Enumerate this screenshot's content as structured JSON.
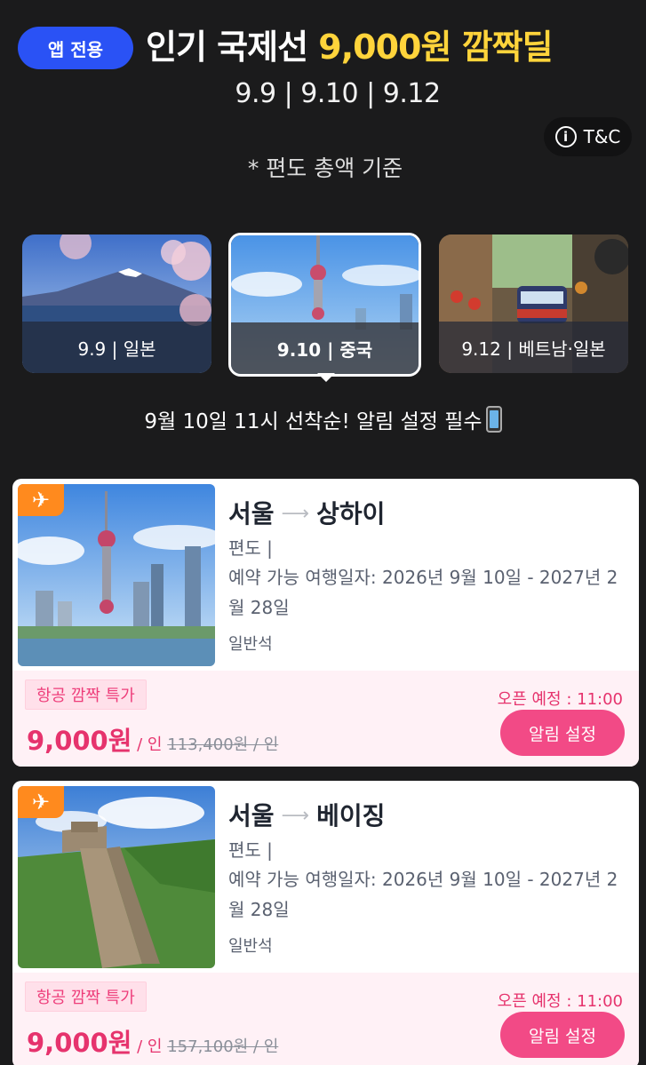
{
  "header": {
    "app_badge": "앱 전용",
    "headline_prefix": "인기 국제선",
    "headline_highlight": "9,000원 깜짝딜",
    "dates": "9.9 | 9.10 | 9.12",
    "tc_label": "T&C",
    "subtitle": "* 편도 총액 기준"
  },
  "tabs": [
    {
      "label": "9.9 | 일본",
      "active": false
    },
    {
      "label": "9.10 | 중국",
      "active": true
    },
    {
      "label": "9.12 | 베트남·일본",
      "active": false
    }
  ],
  "notice": "9월 10일 11시 선착순! 알림 설정 필수",
  "deals": [
    {
      "from": "서울",
      "to": "상하이",
      "trip_type": "편도 |",
      "period": "예약 가능 여행일자:  2026년 9월 10일  - 2027년 2월 28일",
      "cabin": "일반석",
      "promo": "항공 깜짝 특가",
      "price": "9,000원",
      "per": " / 인 ",
      "original_price": "113,400원 / 인",
      "open_time": "오픈 예정 : 11:00",
      "button": "알림 설정"
    },
    {
      "from": "서울",
      "to": "베이징",
      "trip_type": "편도 |",
      "period": "예약 가능 여행일자:  2026년 9월 10일  - 2027년 2월 28일",
      "cabin": "일반석",
      "promo": "항공 깜짝 특가",
      "price": "9,000원",
      "per": " / 인 ",
      "original_price": "157,100원 / 인",
      "open_time": "오픈 예정 : 11:00",
      "button": "알림 설정"
    }
  ],
  "icons": {
    "plane": "plane-icon",
    "info": "info-icon",
    "arrow": "route-arrow-icon",
    "phone": "mobile-phone-icon"
  },
  "colors": {
    "accent_pink": "#f24a86",
    "highlight_yellow": "#ffd43b",
    "badge_blue": "#2a52f5",
    "plane_tag_orange": "#ff8a1e"
  }
}
